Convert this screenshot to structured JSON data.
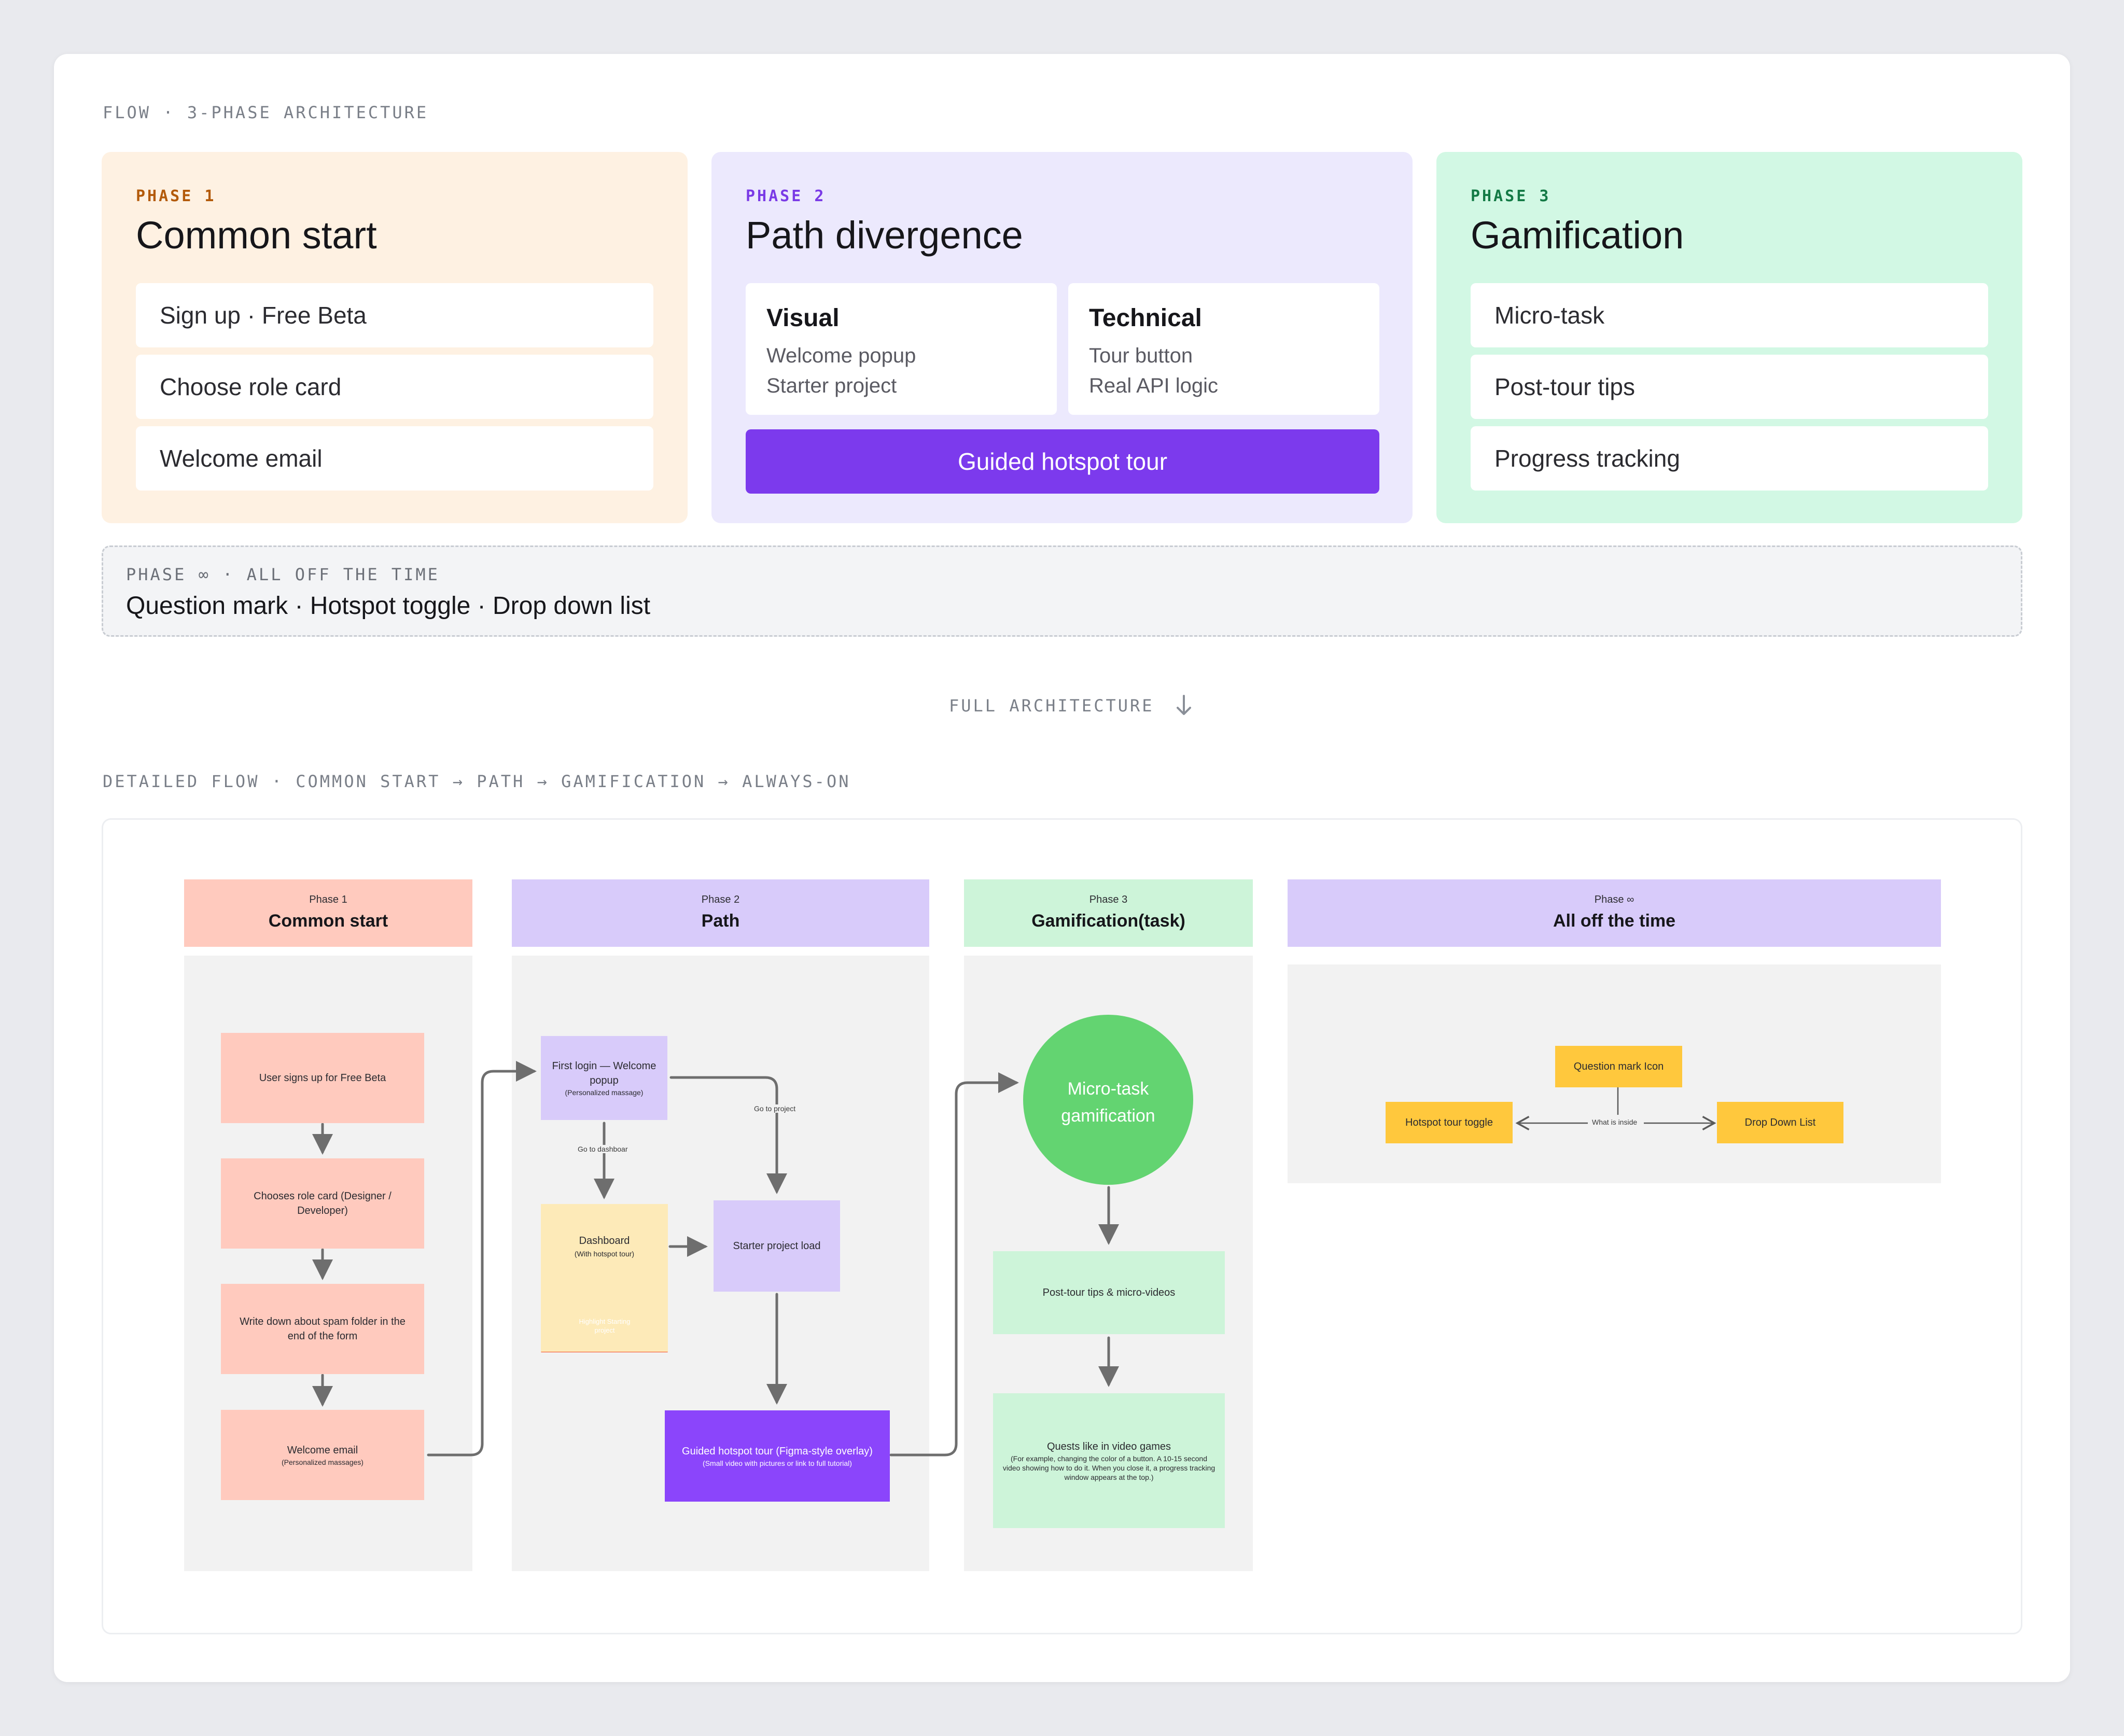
{
  "summary": {
    "section_title": "FLOW · 3-PHASE ARCHITECTURE",
    "phase1": {
      "label": "PHASE 1",
      "title": "Common start",
      "items": [
        "Sign up · Free Beta",
        "Choose role card",
        "Welcome email"
      ]
    },
    "phase2": {
      "label": "PHASE 2",
      "title": "Path divergence",
      "visual": {
        "title": "Visual",
        "lines": [
          "Welcome popup",
          "Starter project"
        ]
      },
      "technical": {
        "title": "Technical",
        "lines": [
          "Tour button",
          "Real API logic"
        ]
      },
      "button": "Guided hotspot tour"
    },
    "phase3": {
      "label": "PHASE 3",
      "title": "Gamification",
      "items": [
        "Micro-task",
        "Post-tour tips",
        "Progress tracking"
      ]
    },
    "always": {
      "label": "PHASE ∞ · ALL OFF THE TIME",
      "text": "Question mark · Hotspot toggle · Drop down list"
    },
    "full_architecture": "FULL ARCHITECTURE",
    "detail_title": "DETAILED FLOW · COMMON START → PATH → GAMIFICATION → ALWAYS-ON"
  },
  "diagram": {
    "columns": [
      {
        "small": "Phase 1",
        "title": "Common start"
      },
      {
        "small": "Phase 2",
        "title": "Path"
      },
      {
        "small": "Phase 3",
        "title": "Gamification(task)"
      },
      {
        "small": "Phase ∞",
        "title": "All off the time"
      }
    ],
    "phase1_nodes": {
      "signup": "User signs up for Free Beta",
      "role": "Chooses role card (Designer / Developer)",
      "spam": "Write down about spam folder in the end of the form",
      "welcome_main": "Welcome email",
      "welcome_sub": "(Personalized massages)"
    },
    "phase2_nodes": {
      "first_login_main": "First login — Welcome popup",
      "first_login_sub": "(Personalized massage)",
      "dashboard_main": "Dashboard",
      "dashboard_sub": "(With hotspot tour)",
      "highlight": "Highlight Starting project",
      "starter": "Starter project load",
      "guided_main": "Guided hotspot tour (Figma-style overlay)",
      "guided_sub": "(Small video with pictures or link to full tutorial)",
      "edge_dashboard": "Go to dashboar",
      "edge_project": "Go to project"
    },
    "phase3_nodes": {
      "circle": "Micro-task gamification",
      "tips": "Post-tour tips & micro-videos",
      "quests_main": "Quests like in video games",
      "quests_sub": "(For example, changing the color of a button. A 10-15 second video showing how to do it. When you close it, a progress tracking window appears at the top.)"
    },
    "always_nodes": {
      "question": "Question mark Icon",
      "toggle": "Hotspot tour toggle",
      "dropdown": "Drop Down List",
      "edge_inside": "What is inside"
    },
    "colors": {
      "phase1": "#ffcabe",
      "phase2": "#d8cbfa",
      "phase3": "#cdf4d9",
      "circle": "#63d471",
      "guided": "#8b45fb",
      "warning": "#f5471f",
      "dashboard": "#fdeab8",
      "always_nodes": "#ffc83d",
      "arrow": "#6e6e6e"
    }
  }
}
